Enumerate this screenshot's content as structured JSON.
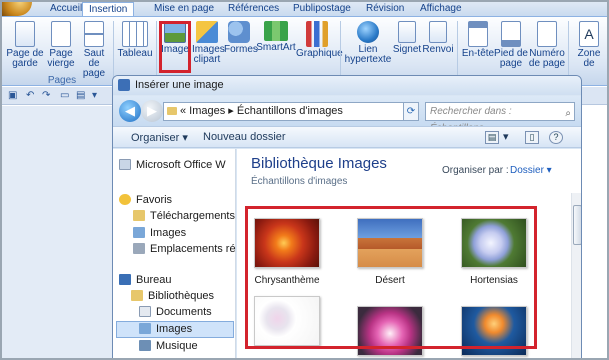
{
  "ribbon": {
    "tabs": [
      "Accueil",
      "Insertion",
      "Mise en page",
      "Références",
      "Publipostage",
      "Révision",
      "Affichage"
    ],
    "active_tab": "Insertion",
    "buttons": {
      "page_garde": "Page de garde",
      "page_vierge": "Page vierge",
      "saut_page": "Saut de page",
      "tableau": "Tableau",
      "image": "Image",
      "images_clipart": "Images clipart",
      "formes": "Formes",
      "smartart": "SmartArt",
      "graphique": "Graphique",
      "lien_hypertexte": "Lien hypertexte",
      "signet": "Signet",
      "renvoi": "Renvoi",
      "en_tete": "En-tête",
      "pied_page": "Pied de page",
      "numero_page": "Numéro de page",
      "zone_texte": "Zone de"
    },
    "group_pages": "Pages"
  },
  "dialog": {
    "title": "Insérer une image",
    "breadcrumb": "« Images ▸ Échantillons d'images",
    "search_placeholder": "Rechercher dans : Échantillons...",
    "commands": {
      "organiser": "Organiser ▾",
      "nouveau_dossier": "Nouveau dossier"
    },
    "nav_items": [
      "Microsoft Office W",
      "Favoris",
      "Téléchargements",
      "Images",
      "Emplacements ré",
      "Bureau",
      "Bibliothèques",
      "Documents",
      "Images",
      "Musique"
    ],
    "library_title": "Bibliothèque Images",
    "library_subtitle": "Échantillons d'images",
    "arrange_label": "Organiser par :",
    "arrange_value": "Dossier ▾",
    "thumbnails": [
      "Chrysanthème",
      "Désert",
      "Hortensias",
      "",
      "",
      ""
    ]
  },
  "colors": {
    "highlight": "#d3232d",
    "accent": "#1e3f8a"
  }
}
